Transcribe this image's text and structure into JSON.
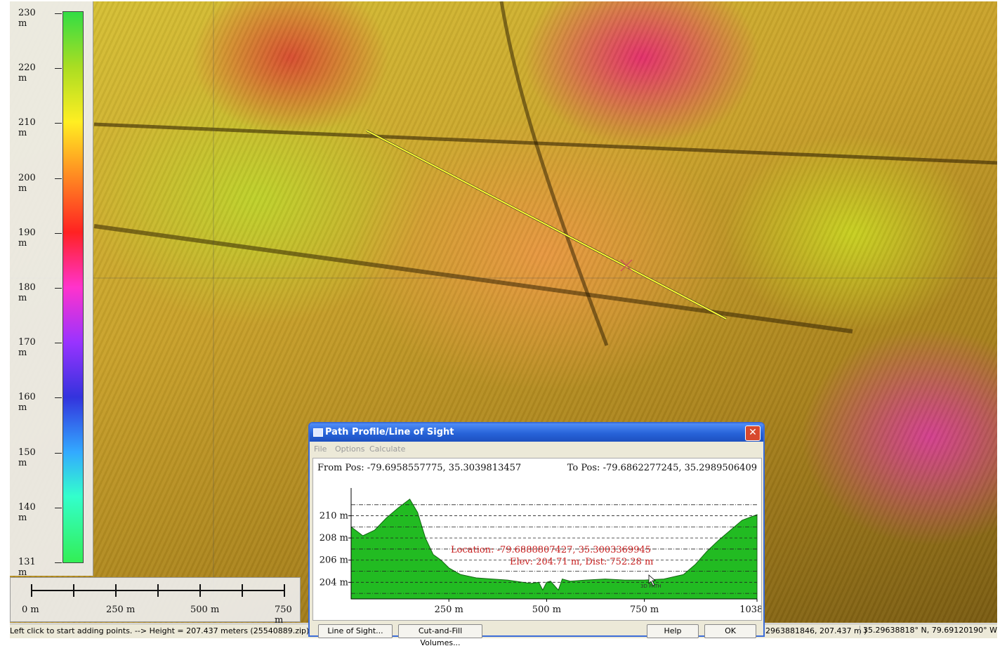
{
  "legend": {
    "ticks": [
      "230 m",
      "220 m",
      "210 m",
      "200 m",
      "190 m",
      "180 m",
      "170 m",
      "160 m",
      "150 m",
      "140 m",
      "131 m"
    ]
  },
  "scalebar": {
    "labels": [
      "0 m",
      "250 m",
      "500 m",
      "750 m"
    ]
  },
  "status": {
    "left": "Left click to start adding points. --> Height = 207.437 meters (25540889.zip)",
    "middle": "2963881846, 207.437 m )",
    "right": "35.29638818° N, 79.69120190° W"
  },
  "dialog": {
    "title": "Path Profile/Line of Sight",
    "close_label": "✕",
    "menu": [
      "File",
      "Options",
      "Calculate"
    ],
    "from_pos": "From Pos: -79.6958557775, 35.3039813457",
    "to_pos": "To Pos: -79.6862277245, 35.2989506409",
    "cursor_location": "Location: -79.6888807427, 35.3003369945",
    "cursor_elev": "Elev: 204.71 m, Dist: 752.28 m",
    "watermark": "3D PATH",
    "buttons": {
      "line_of_sight": "Line of Sight...",
      "cut_fill": "Cut-and-Fill Volumes...",
      "help": "Help",
      "ok": "OK"
    }
  },
  "chart_data": {
    "type": "area",
    "x_tick_labels": [
      "250 m",
      "500 m",
      "750 m",
      "1038 m"
    ],
    "y_tick_labels": [
      "204 m",
      "206 m",
      "208 m",
      "210 m"
    ],
    "xlim": [
      0,
      1038
    ],
    "ylim": [
      202.5,
      212
    ],
    "x": [
      0,
      30,
      60,
      90,
      120,
      150,
      170,
      190,
      210,
      230,
      250,
      280,
      320,
      360,
      400,
      440,
      460,
      480,
      490,
      500,
      510,
      530,
      540,
      560,
      600,
      650,
      700,
      750,
      800,
      850,
      880,
      910,
      940,
      970,
      1000,
      1038
    ],
    "y": [
      209,
      208.2,
      208.7,
      209.8,
      210.7,
      211.5,
      210.3,
      208,
      206.5,
      206,
      205.3,
      204.7,
      204.4,
      204.3,
      204.2,
      204,
      203.9,
      204,
      203.3,
      204,
      204.1,
      203.3,
      204.3,
      204.1,
      204.2,
      204.3,
      204.2,
      204.2,
      204.3,
      204.7,
      205.6,
      206.8,
      207.8,
      208.7,
      209.6,
      210.1
    ],
    "color": "#22bb22"
  }
}
